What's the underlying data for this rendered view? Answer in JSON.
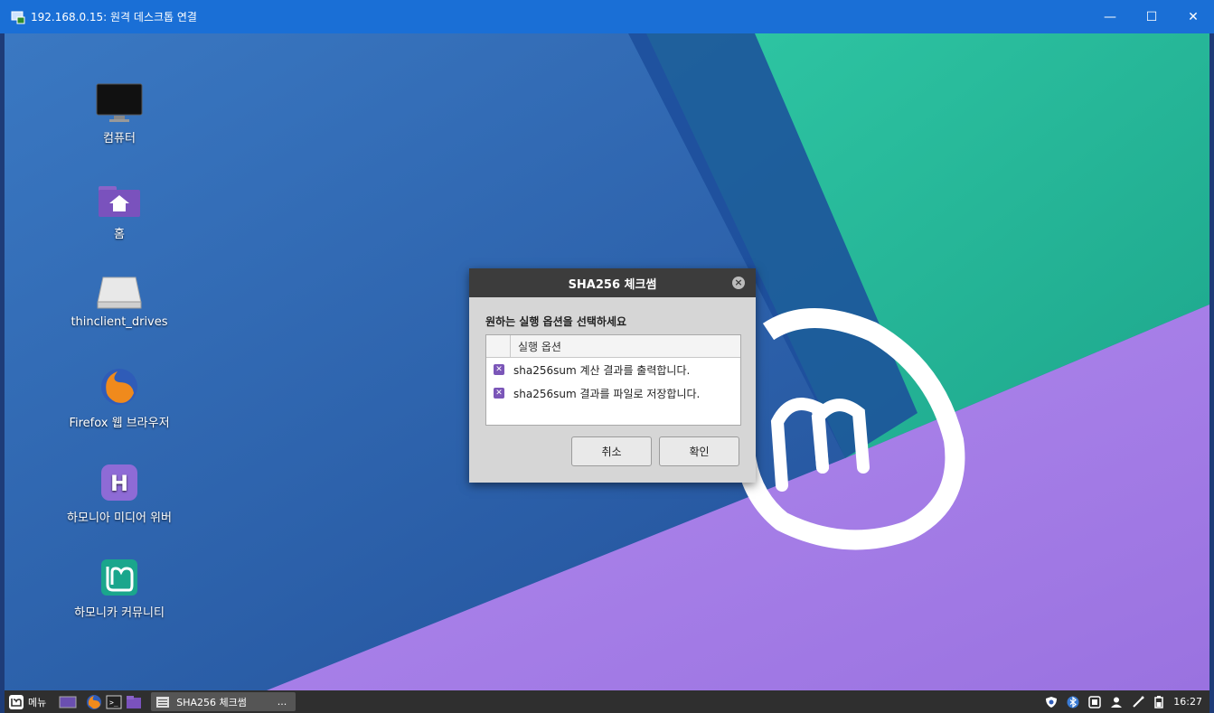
{
  "window": {
    "title": "192.168.0.15: 원격 데스크톱 연결",
    "minimize": "—",
    "maximize": "☐",
    "close": "✕"
  },
  "desktop": {
    "icons": [
      {
        "label": "컴퓨터"
      },
      {
        "label": "홈"
      },
      {
        "label": "thinclient_drives"
      },
      {
        "label": "Firefox 웹 브라우저"
      },
      {
        "label": "하모니아 미디어 위버"
      },
      {
        "label": "하모니카 커뮤니티"
      }
    ]
  },
  "dialog": {
    "title": "SHA256 체크썸",
    "prompt": "원하는 실행 옵션을 선택하세요",
    "column_header": "실행 옵션",
    "options": [
      {
        "label": "sha256sum 계산 결과를 출력합니다.",
        "checked": true
      },
      {
        "label": "sha256sum 결과를 파일로 저장합니다.",
        "checked": true
      }
    ],
    "cancel": "취소",
    "ok": "확인"
  },
  "taskbar": {
    "menu_label": "메뉴",
    "task_label": "SHA256 체크썸",
    "task_more": "...",
    "clock": "16:27"
  }
}
